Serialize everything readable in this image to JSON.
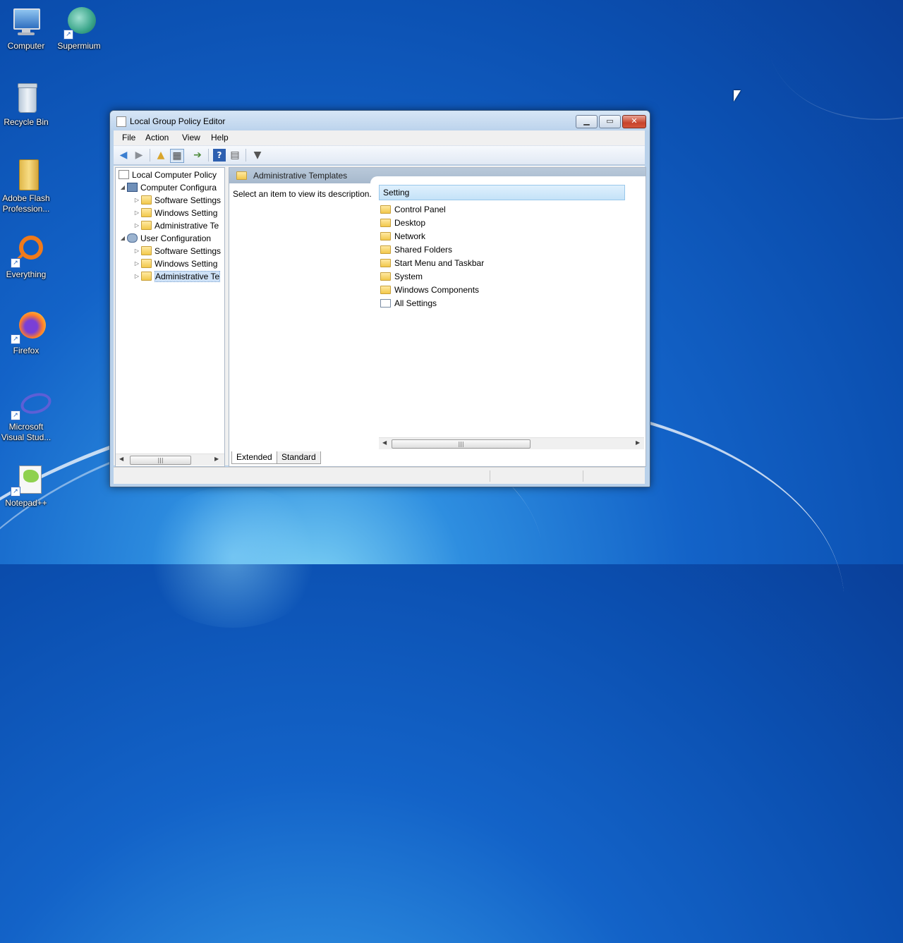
{
  "desktop": {
    "icons": [
      {
        "label": "Computer",
        "icon": "computer-icon"
      },
      {
        "label": "Supermium",
        "icon": "supermium-icon"
      },
      {
        "label": "Recycle Bin",
        "icon": "recycle-bin-icon"
      },
      {
        "label": "Adobe Flash Profession...",
        "icon": "folder-icon"
      },
      {
        "label": "Everything",
        "icon": "everything-icon"
      },
      {
        "label": "Firefox",
        "icon": "firefox-icon"
      },
      {
        "label": "Microsoft Visual Stud...",
        "icon": "visual-studio-icon"
      },
      {
        "label": "Notepad++",
        "icon": "notepad-plus-plus-icon"
      }
    ]
  },
  "window": {
    "title": "Local Group Policy Editor",
    "menu": [
      "File",
      "Action",
      "View",
      "Help"
    ],
    "tree": {
      "root": "Local Computer Policy",
      "computer_config": "Computer Configura",
      "computer_children": [
        "Software Settings",
        "Windows Setting",
        "Administrative Te"
      ],
      "user_config": "User Configuration",
      "user_children": [
        "Software Settings",
        "Windows Setting",
        "Administrative Te"
      ]
    },
    "right": {
      "header": "Administrative Templates",
      "description": "Select an item to view its description.",
      "column_header": "Setting",
      "items": [
        {
          "label": "Control Panel",
          "icon": "folder-icon"
        },
        {
          "label": "Desktop",
          "icon": "folder-icon"
        },
        {
          "label": "Network",
          "icon": "folder-icon"
        },
        {
          "label": "Shared Folders",
          "icon": "folder-icon"
        },
        {
          "label": "Start Menu and Taskbar",
          "icon": "folder-icon"
        },
        {
          "label": "System",
          "icon": "folder-icon"
        },
        {
          "label": "Windows Components",
          "icon": "folder-icon"
        },
        {
          "label": "All Settings",
          "icon": "all-settings-icon"
        }
      ]
    },
    "tabs": [
      "Extended",
      "Standard"
    ],
    "active_tab": "Extended"
  },
  "colors": {
    "desktop_blue": "#1363c8",
    "title_bar": "#bcd3ec",
    "close_button": "#c7432c",
    "list_header": "#c4e2f8"
  }
}
